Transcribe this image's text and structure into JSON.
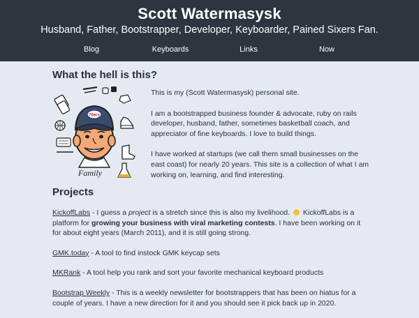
{
  "header": {
    "title": "Scott Watermasysk",
    "tagline": "Husband, Father, Bootstrapper, Developer, Keyboarder, Pained Sixers Fan."
  },
  "nav": [
    {
      "label": "Blog"
    },
    {
      "label": "Keyboards"
    },
    {
      "label": "Links"
    },
    {
      "label": "Now"
    }
  ],
  "about": {
    "heading": "What the hell is this?",
    "avatar_caption": "Family",
    "avatar_badge": "76ers",
    "paragraphs": [
      "This is my (Scott Watermasysk) personal site.",
      "I am a bootstrapped business founder & advocate, ruby on rails developer, husband, father, sometimes basketball coach, and appreciator of fine keyboards. I love to build things.",
      "I have worked at startups (we call them small businesses on the east coast) for nearly 20 years. This site is a collection of what I am working on, learning, and find interesting."
    ]
  },
  "projects": {
    "heading": "Projects",
    "items": [
      {
        "link": "KickoffLabs",
        "t1": " - I guess a ",
        "em": "project",
        "t2": " is a stretch since this is also my livelihood.",
        "t3": " KickoffLabs is a platform for ",
        "strong": "growing your business with viral marketing contests",
        "t4": ". I have been working on it for about eight years (March 2011), and it is still going strong."
      },
      {
        "link": "GMK.today",
        "text": " - A tool to find instock GMK keycap sets"
      },
      {
        "link": "MKRank",
        "text": " - A tool help you rank and sort your favorite mechanical keyboard products"
      },
      {
        "link": "Bootstrap Weekly",
        "text": " - This is a weekly newsletter for bootstrappers that has been on hiatus for a couple of years. I have a new direction for it and you should see it pick back up in 2020."
      }
    ]
  }
}
